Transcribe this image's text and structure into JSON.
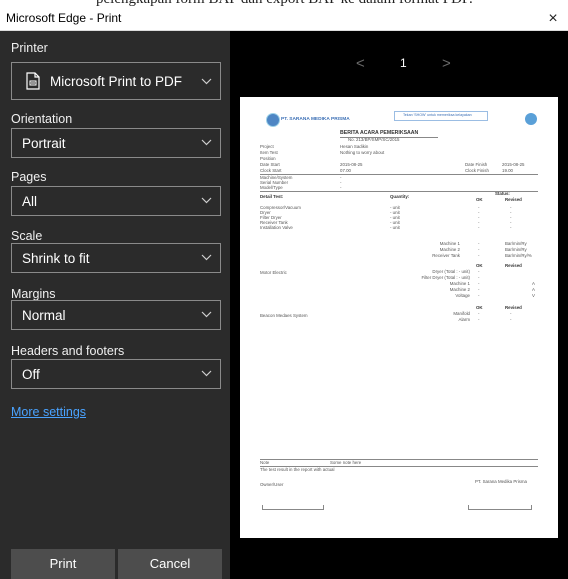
{
  "top_strip_text": "pelengkapan form BAP dan export BAP ke dalam format PDF.",
  "window": {
    "title": "Microsoft Edge - Print",
    "close_glyph": "×"
  },
  "settings": {
    "printer": {
      "label": "Printer",
      "value": "Microsoft Print to PDF",
      "icon": "printer-pdf-icon"
    },
    "orientation": {
      "label": "Orientation",
      "value": "Portrait"
    },
    "pages": {
      "label": "Pages",
      "value": "All"
    },
    "scale": {
      "label": "Scale",
      "value": "Shrink to fit"
    },
    "margins": {
      "label": "Margins",
      "value": "Normal"
    },
    "headers_footers": {
      "label": "Headers and footers",
      "value": "Off"
    },
    "more_settings": "More settings"
  },
  "buttons": {
    "print": "Print",
    "cancel": "Cancel"
  },
  "preview": {
    "prev": "<",
    "next": ">",
    "page_number": "1",
    "doc": {
      "logo_text": "PT. SARANA MEDIKA PRISMA",
      "link_text": "Tekan 'SHOW' untuk memeriksa kelayakan",
      "title": "BERITA ACARA PEMERIKSAAN",
      "subtitle": "No. 213/BP/SMP/SC/2015",
      "info": [
        [
          "Project",
          "Hesan Sadikin"
        ],
        [
          "Item Test",
          "Nothing to worry about"
        ],
        [
          "Position",
          ""
        ],
        [
          "Date Start",
          "2015-08-25"
        ],
        [
          "Clock Start",
          "07.00"
        ]
      ],
      "info_right": [
        [
          "Date Finish",
          "2015-08-25"
        ],
        [
          "Clock Finish",
          "19.00"
        ]
      ],
      "machine": [
        "Machine/System",
        "Serial Number",
        "Model/Type"
      ],
      "detail_header": "Detail Test:",
      "quantity_header": "Quantity:",
      "status_header": "Status:",
      "ok_label": "OK",
      "revised_label": "Revised",
      "items": [
        [
          "Compressor/Vacuum",
          "- unit"
        ],
        [
          "Dryer",
          "- unit"
        ],
        [
          "Filter Dryer",
          "- unit"
        ],
        [
          "Receiver Tank",
          "- unit"
        ],
        [
          "Installation Valve",
          "- unit"
        ]
      ],
      "machine_rows": [
        [
          "Machine 1",
          "-",
          "Bar/min/Ry"
        ],
        [
          "Machine 2",
          "-",
          "Bar/min/Ry"
        ],
        [
          "Receiver Tank",
          "-",
          "Bar/min/Ry/%"
        ]
      ],
      "motor_label": "Motor Electric",
      "motor_rows": [
        [
          "Dryer (Total : - unit)",
          "-",
          ""
        ],
        [
          "Filter Dryer (Total : - unit)",
          "-",
          ""
        ],
        [
          "Machine 1",
          "-",
          "A"
        ],
        [
          "Machine 2",
          "-",
          "A"
        ],
        [
          "Voltage",
          "-",
          "V"
        ]
      ],
      "beacon_label": "Beacon Medaes System",
      "beacon_rows": [
        [
          "Manifold",
          "-",
          "-"
        ],
        [
          "Alarm",
          "-",
          "-"
        ]
      ],
      "note_label": "Note",
      "note_value": "Some note here",
      "result_text": "The test result in the report with actual",
      "owner_label": "Owner/User",
      "company_sign": "PT. Sarana Medika Prisma"
    }
  }
}
